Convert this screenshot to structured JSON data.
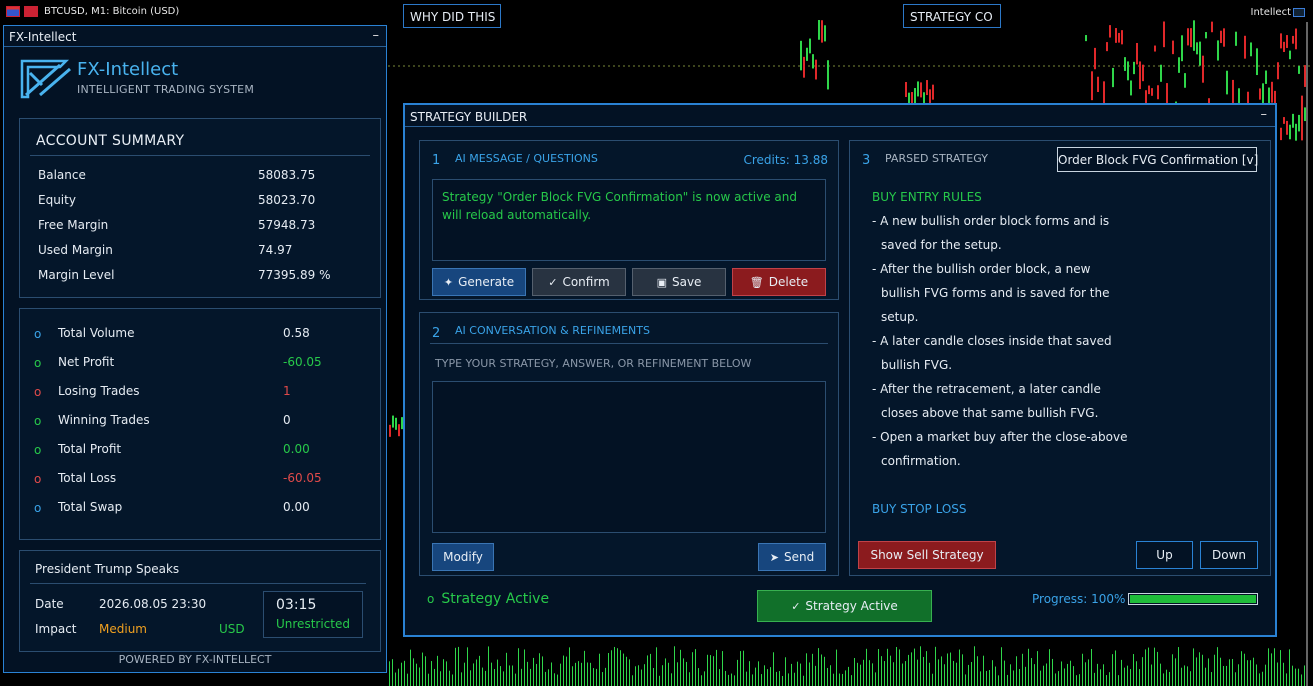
{
  "chart": {
    "symbol_title": "BTCUSD, M1:  Bitcoin (USD)",
    "badge": "Intellect",
    "why_button": "WHY DID THIS",
    "strategy_button": "STRATEGY CO"
  },
  "left_panel": {
    "title": "FX-Intellect",
    "brand_name": "FX-Intellect",
    "brand_sub": "INTELLIGENT TRADING SYSTEM",
    "account": {
      "heading": "ACCOUNT SUMMARY",
      "rows": [
        {
          "label": "Balance",
          "value": "58083.75"
        },
        {
          "label": "Equity",
          "value": "58023.70"
        },
        {
          "label": "Free Margin",
          "value": "57948.73"
        },
        {
          "label": "Used Margin",
          "value": "74.97"
        },
        {
          "label": "Margin Level",
          "value": "77395.89 %"
        }
      ]
    },
    "stats": [
      {
        "label": "Total Volume",
        "value": "0.58",
        "dot": "o",
        "dot_color": "#3aa3e8",
        "value_color": "#e6ecf3"
      },
      {
        "label": "Net Profit",
        "value": "-60.05",
        "dot": "o",
        "dot_color": "#27c94a",
        "value_color": "#27c94a"
      },
      {
        "label": "Losing Trades",
        "value": "1",
        "dot": "o",
        "dot_color": "#e04a4a",
        "value_color": "#e04a4a"
      },
      {
        "label": "Winning Trades",
        "value": "0",
        "dot": "o",
        "dot_color": "#27c94a",
        "value_color": "#e6ecf3"
      },
      {
        "label": "Total Profit",
        "value": "0.00",
        "dot": "o",
        "dot_color": "#27c94a",
        "value_color": "#27c94a"
      },
      {
        "label": "Total Loss",
        "value": "-60.05",
        "dot": "o",
        "dot_color": "#e04a4a",
        "value_color": "#e04a4a"
      },
      {
        "label": "Total Swap",
        "value": "0.00",
        "dot": "o",
        "dot_color": "#3aa3e8",
        "value_color": "#e6ecf3"
      }
    ],
    "news": {
      "title": "President Trump Speaks",
      "date_label": "Date",
      "date_value": "2026.08.05 23:30",
      "impact_label": "Impact",
      "impact_value": "Medium",
      "currency": "USD",
      "countdown": "03:15",
      "countdown_status": "Unrestricted"
    },
    "powered_by": "POWERED BY FX-INTELLECT"
  },
  "builder": {
    "title": "STRATEGY BUILDER",
    "section1": {
      "num": "1",
      "title": "AI MESSAGE  /  QUESTIONS",
      "credits": "Credits: 13.88",
      "message": "Strategy \"Order Block FVG Confirmation\" is now active and will reload automatically.",
      "buttons": {
        "generate": "Generate",
        "confirm": "Confirm",
        "save": "Save",
        "delete": "Delete"
      }
    },
    "section2": {
      "num": "2",
      "title": "AI CONVERSATION & REFINEMENTS",
      "hint": "TYPE YOUR STRATEGY, ANSWER, OR REFINEMENT BELOW",
      "input_value": "",
      "modify": "Modify",
      "send": "Send"
    },
    "section3": {
      "num": "3",
      "title": "PARSED STRATEGY",
      "selected_strategy": "Order Block FVG Confirmation  [v]",
      "buy_entry_heading": "BUY ENTRY RULES",
      "rules": [
        "- A new bullish order block forms and is",
        "saved for the setup.",
        "- After the bullish order block, a new",
        "bullish FVG forms and is saved for the",
        "setup.",
        "- A later candle closes inside that saved",
        "bullish FVG.",
        "- After the retracement, a later candle",
        "closes above that same bullish FVG.",
        "- Open a market buy after the close-above",
        "confirmation."
      ],
      "buy_stop_heading": "BUY STOP LOSS",
      "show_sell": "Show Sell Strategy",
      "up": "Up",
      "down": "Down"
    },
    "status": {
      "dot": "o",
      "text": "Strategy Active"
    },
    "active_button": "Strategy Active",
    "progress_label": "Progress: 100%",
    "progress_value": 1.0
  }
}
